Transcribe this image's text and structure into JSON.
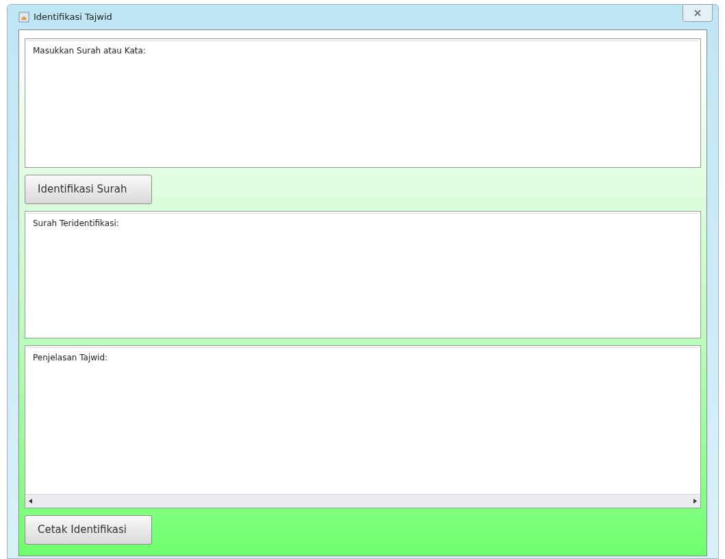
{
  "window": {
    "title": "Identifikasi Tajwid"
  },
  "input_area": {
    "label": "Masukkan Surah atau Kata:"
  },
  "identify_button": {
    "label": "Identifikasi Surah"
  },
  "result_area": {
    "label": "Surah Teridentifikasi:"
  },
  "explanation_area": {
    "label": "Penjelasan Tajwid:"
  },
  "print_button": {
    "label": "Cetak Identifikasi"
  }
}
